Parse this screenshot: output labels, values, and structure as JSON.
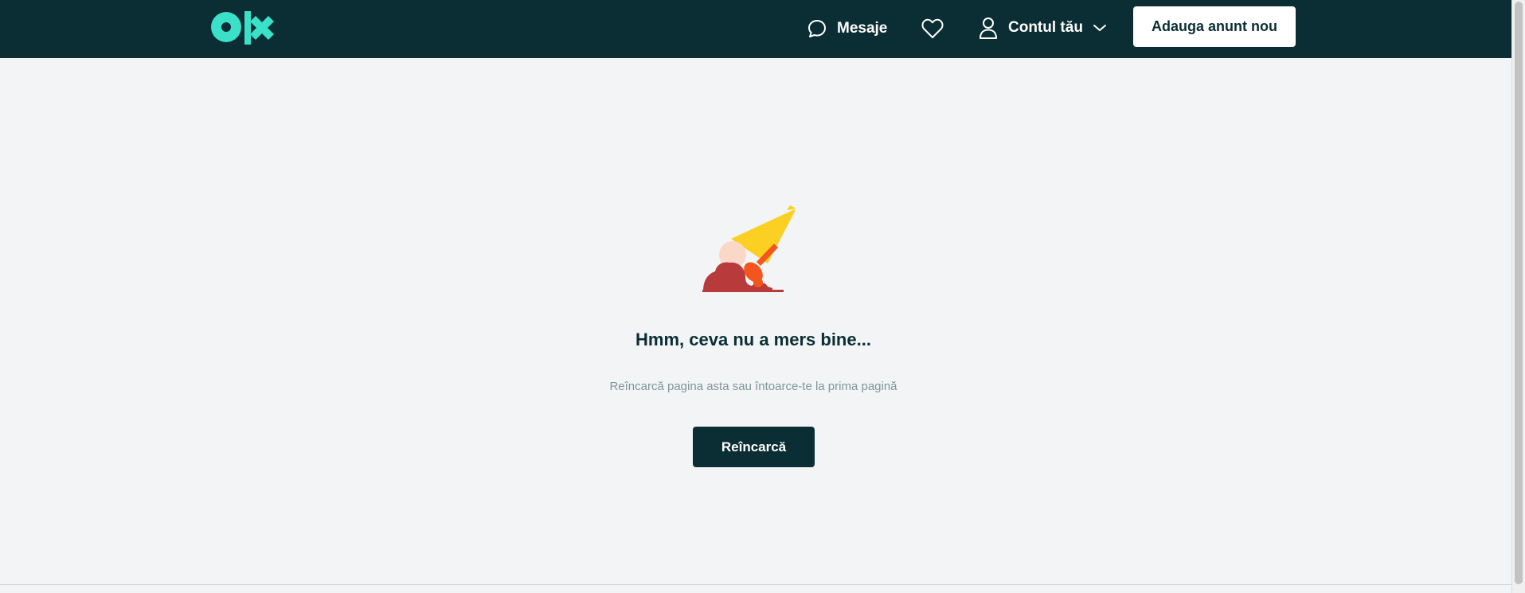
{
  "header": {
    "logo_alt": "olx",
    "messages_label": "Mesaje",
    "account_label": "Contul tău",
    "post_ad_label": "Adauga anunt nou"
  },
  "error": {
    "title": "Hmm, ceva nu a mers bine...",
    "subtitle": "Reîncarcă pagina asta sau întoarce-te la prima pagină",
    "reload_label": "Reîncarcă"
  },
  "colors": {
    "header_bg": "#0b2e35",
    "logo_accent": "#3ae0c8",
    "page_bg": "#f2f4f5",
    "cone_yellow": "#fbd022",
    "ice_cream_red": "#b93a3a",
    "ice_cream_orange": "#f4541d",
    "ice_cream_pink": "#fbd7c7"
  },
  "icons": {
    "logo": "olx-logo",
    "messages": "chat-bubble-icon",
    "favorites": "heart-icon",
    "account": "user-icon",
    "account_menu": "chevron-down-icon",
    "illustration": "dropped-ice-cream-icon"
  }
}
